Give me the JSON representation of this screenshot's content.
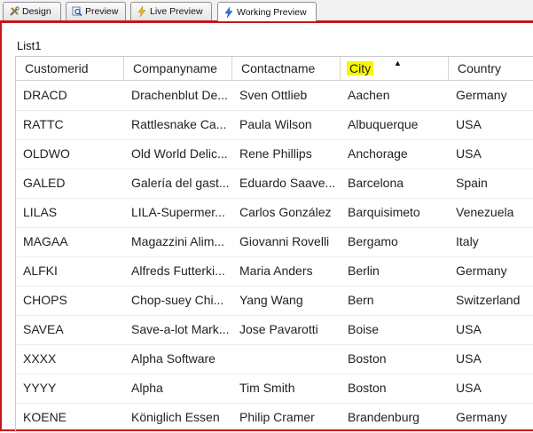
{
  "tabs": [
    {
      "label": "Design",
      "icon": "design-tools-icon"
    },
    {
      "label": "Preview",
      "icon": "preview-magnifier-icon"
    },
    {
      "label": "Live Preview",
      "icon": "lightning-icon"
    },
    {
      "label": "Working Preview",
      "icon": "lightning-icon",
      "active": true
    }
  ],
  "list": {
    "title": "List1",
    "sort_indicator": "▲",
    "columns": [
      "Customerid",
      "Companyname",
      "Contactname",
      "City",
      "Country"
    ],
    "highlight_color": "#f8f700",
    "rows": [
      [
        "DRACD",
        "Drachenblut De...",
        "Sven Ottlieb",
        "Aachen",
        "Germany"
      ],
      [
        "RATTC",
        "Rattlesnake Ca...",
        "Paula Wilson",
        "Albuquerque",
        "USA"
      ],
      [
        "OLDWO",
        "Old World Delic...",
        "Rene Phillips",
        "Anchorage",
        "USA"
      ],
      [
        "GALED",
        "Galería del gast...",
        "Eduardo Saave...",
        "Barcelona",
        "Spain"
      ],
      [
        "LILAS",
        "LILA-Supermer...",
        "Carlos González",
        "Barquisimeto",
        "Venezuela"
      ],
      [
        "MAGAA",
        "Magazzini Alim...",
        "Giovanni Rovelli",
        "Bergamo",
        "Italy"
      ],
      [
        "ALFKI",
        "Alfreds Futterki...",
        "Maria Anders",
        "Berlin",
        "Germany"
      ],
      [
        "CHOPS",
        "Chop-suey Chi...",
        "Yang Wang",
        "Bern",
        "Switzerland"
      ],
      [
        "SAVEA",
        "Save-a-lot Mark...",
        "Jose Pavarotti",
        "Boise",
        "USA"
      ],
      [
        "XXXX",
        "Alpha Software",
        "",
        "Boston",
        "USA"
      ],
      [
        "YYYY",
        "Alpha",
        "Tim Smith",
        "Boston",
        "USA"
      ],
      [
        "KOENE",
        "Königlich Essen",
        "Philip Cramer",
        "Brandenburg",
        "Germany"
      ]
    ]
  },
  "colors": {
    "border_accent": "#c9141b",
    "highlight": "#f8f700"
  }
}
